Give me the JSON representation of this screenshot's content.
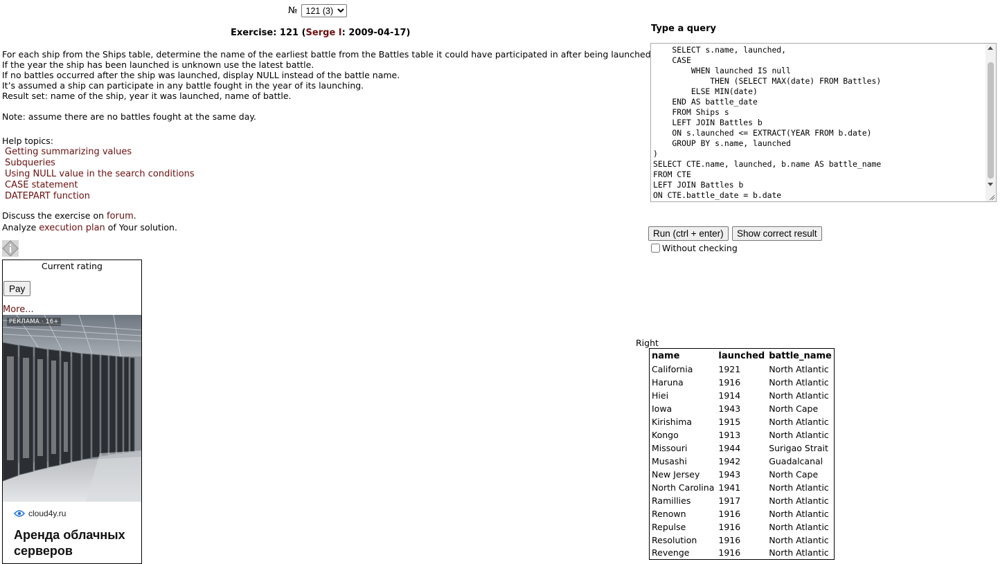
{
  "header": {
    "number_symbol": "№",
    "exercise_select_value": "121 (3)"
  },
  "exercise": {
    "label": "Exercise: 121 (",
    "author": "Serge I",
    "date_part": ": 2009-04-17)"
  },
  "description": [
    "For each ship from the Ships table, determine the name of the earliest battle from the Battles table it could have participated in after being launched.",
    "If the year the ship has been launched is unknown use the latest battle.",
    "If no battles occurred after the ship was launched, display NULL instead of the battle name.",
    "It’s assumed a ship can participate in any battle fought in the year of its launching.",
    "Result set: name of the ship, year it was launched, name of battle."
  ],
  "note": "Note: assume there are no battles fought at the same day.",
  "help": {
    "title": "Help topics:",
    "links": [
      "Getting summarizing values",
      "Subqueries",
      "Using NULL value in the search conditions",
      "CASE statement",
      "DATEPART function"
    ]
  },
  "discuss": {
    "prefix": "Discuss the exercise on ",
    "forum_link": "forum",
    "suffix": "."
  },
  "analyze": {
    "prefix": "Analyze ",
    "plan_link": "execution plan",
    "suffix": " of Your solution."
  },
  "rating": {
    "title": "Current rating",
    "pay_label": "Pay",
    "more_label": "More..."
  },
  "ad": {
    "label": "РЕКЛАМА · 16+",
    "domain": "cloud4y.ru",
    "headline": "Аренда облачных серверов"
  },
  "query": {
    "label": "Type a query",
    "code": "    SELECT s.name, launched,\n    CASE\n        WHEN launched IS null\n            THEN (SELECT MAX(date) FROM Battles)\n        ELSE MIN(date)\n    END AS battle_date\n    FROM Ships s\n    LEFT JOIN Battles b\n    ON s.launched <= EXTRACT(YEAR FROM b.date)\n    GROUP BY s.name, launched\n)\nSELECT CTE.name, launched, b.name AS battle_name\nFROM CTE\nLEFT JOIN Battles b\nON CTE.battle_date = b.date"
  },
  "actions": {
    "run_label": "Run (ctrl + enter)",
    "show_label": "Show correct result",
    "without_checking_label": "Without checking"
  },
  "result": {
    "label": "Right",
    "columns": [
      "name",
      "launched",
      "battle_name"
    ],
    "rows": [
      [
        "California",
        "1921",
        "North Atlantic"
      ],
      [
        "Haruna",
        "1916",
        "North Atlantic"
      ],
      [
        "Hiei",
        "1914",
        "North Atlantic"
      ],
      [
        "Iowa",
        "1943",
        "North Cape"
      ],
      [
        "Kirishima",
        "1915",
        "North Atlantic"
      ],
      [
        "Kongo",
        "1913",
        "North Atlantic"
      ],
      [
        "Missouri",
        "1944",
        "Surigao Strait"
      ],
      [
        "Musashi",
        "1942",
        "Guadalcanal"
      ],
      [
        "New Jersey",
        "1943",
        "North Cape"
      ],
      [
        "North Carolina",
        "1941",
        "North Atlantic"
      ],
      [
        "Ramillies",
        "1917",
        "North Atlantic"
      ],
      [
        "Renown",
        "1916",
        "North Atlantic"
      ],
      [
        "Repulse",
        "1916",
        "North Atlantic"
      ],
      [
        "Resolution",
        "1916",
        "North Atlantic"
      ],
      [
        "Revenge",
        "1916",
        "North Atlantic"
      ]
    ]
  },
  "colors": {
    "link": "#6b0f0f",
    "text": "#000000"
  }
}
